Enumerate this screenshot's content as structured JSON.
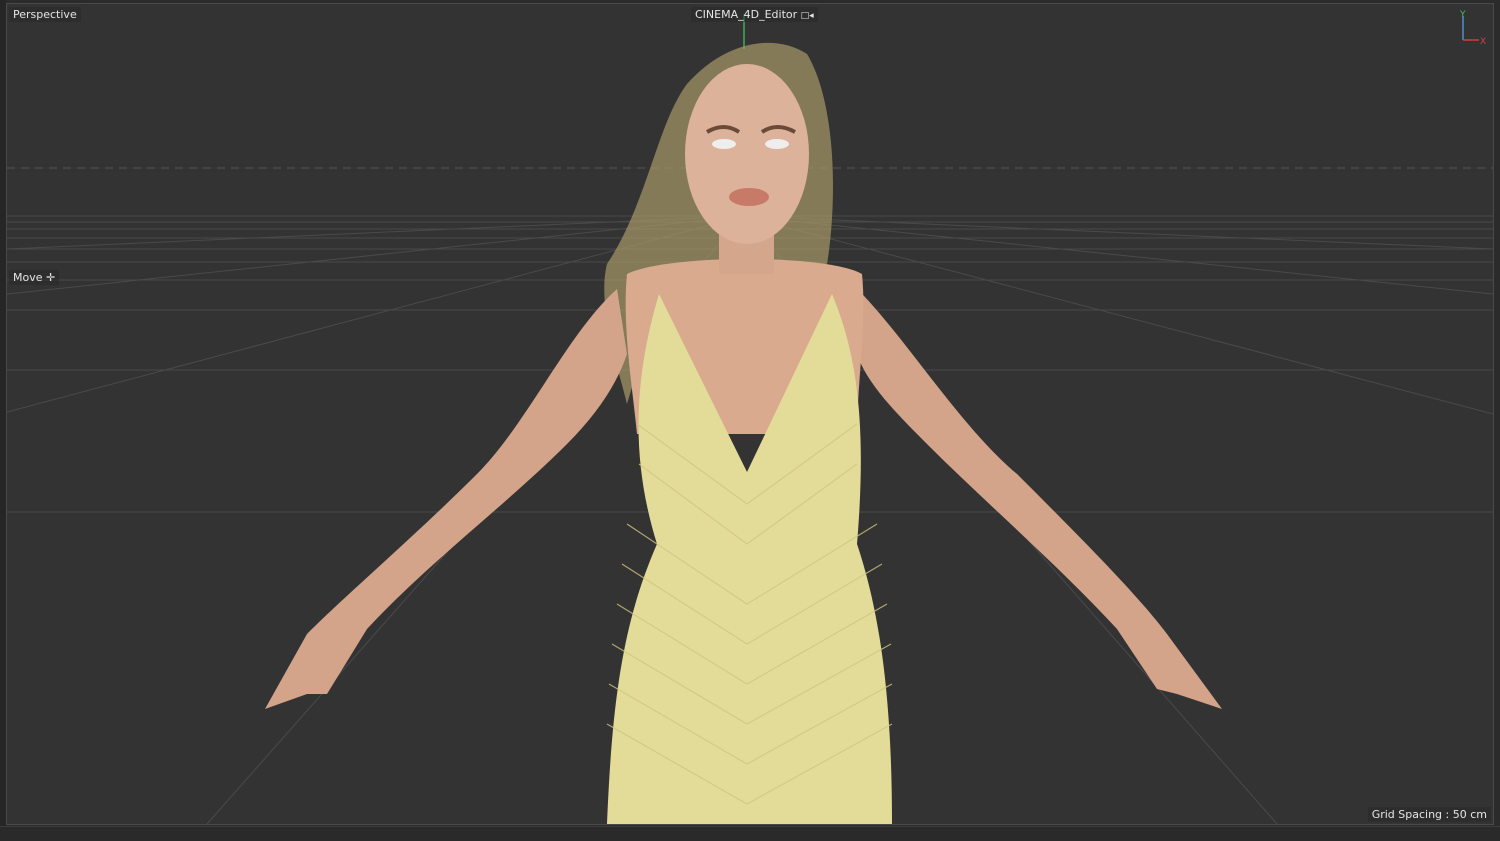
{
  "viewport": {
    "view_name": "Perspective",
    "camera_name": "CINEMA_4D_Editor",
    "camera_icon": "camera-lock-icon",
    "tool_label": "Move",
    "tool_icon": "move-icon",
    "grid_spacing": "Grid Spacing : 50 cm",
    "axis": {
      "x_label": "X",
      "y_label": "Y",
      "x_color": "#d04040",
      "y_color": "#40c060",
      "z_color": "#4a90d0"
    }
  },
  "colors": {
    "viewport_bg": "#333333",
    "dress": "#e6df9a",
    "skin": "#d9a98c"
  }
}
